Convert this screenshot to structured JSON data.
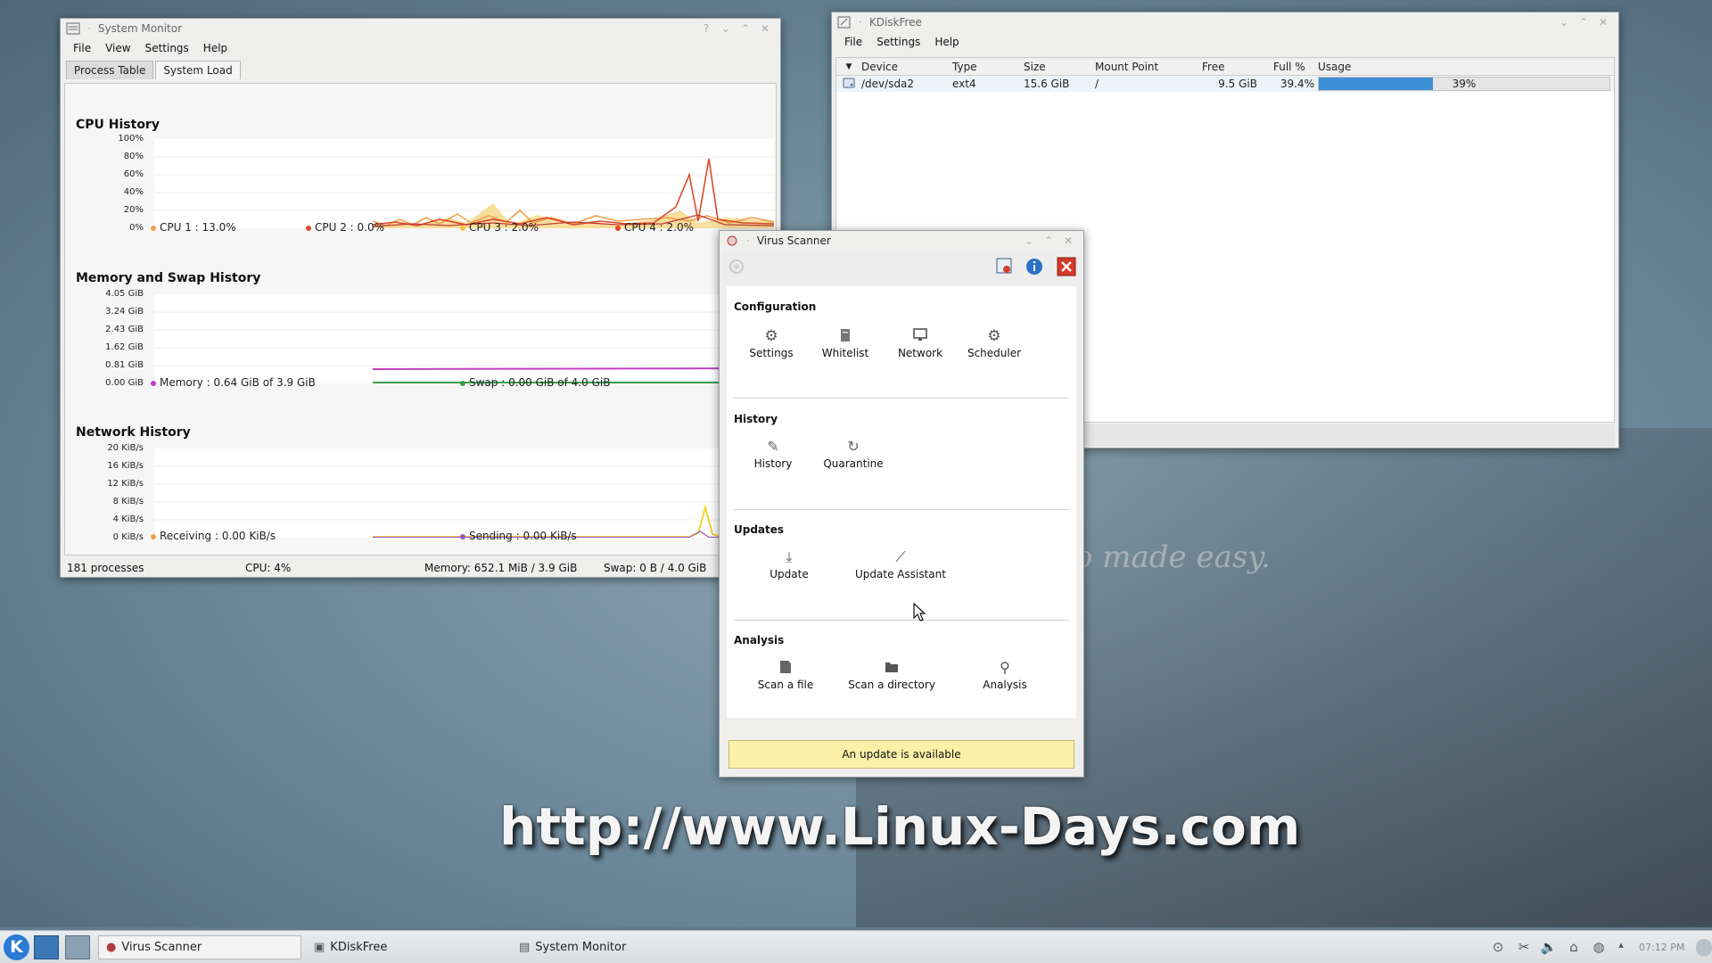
{
  "desktop": {
    "slogan": "o made easy.",
    "watermark": "http://www.Linux-Days.com"
  },
  "sysmon": {
    "title": "System Monitor",
    "menu": [
      "File",
      "View",
      "Settings",
      "Help"
    ],
    "tabs": [
      "Process Table",
      "System Load"
    ],
    "cpu": {
      "title": "CPU History",
      "yticks": [
        "100%",
        "80%",
        "60%",
        "40%",
        "20%",
        "0%"
      ],
      "legend": [
        "CPU 1 : 13.0%",
        "CPU 2 : 0.0%",
        "CPU 3 : 2.0%",
        "CPU 4 : 2.0%"
      ],
      "colors": [
        "#f0a04b",
        "#d94a2a",
        "#f5c542",
        "#e0442a"
      ]
    },
    "memory": {
      "title": "Memory and Swap History",
      "yticks": [
        "4.05 GiB",
        "3.24 GiB",
        "2.43 GiB",
        "1.62 GiB",
        "0.81 GiB",
        "0.00 GiB"
      ],
      "legend": [
        "Memory : 0.64 GiB of 3.9 GiB",
        "Swap : 0.00 GiB of 4.0 GiB"
      ],
      "colors": [
        "#c03fc0",
        "#3aa04a"
      ]
    },
    "network": {
      "title": "Network History",
      "yticks": [
        "20 KiB/s",
        "16 KiB/s",
        "12 KiB/s",
        "8 KiB/s",
        "4 KiB/s",
        "0 KiB/s"
      ],
      "legend": [
        "Receiving : 0.00 KiB/s",
        "Sending : 0.00 KiB/s"
      ],
      "colors": [
        "#f0a04b",
        "#9a5ab8"
      ]
    },
    "status": {
      "processes": "181 processes",
      "cpu": "CPU: 4%",
      "memory": "Memory: 652.1 MiB / 3.9 GiB",
      "swap": "Swap: 0 B / 4.0 GiB"
    }
  },
  "kdf": {
    "title": "KDiskFree",
    "menu": [
      "File",
      "Settings",
      "Help"
    ],
    "columns": [
      "Device",
      "Type",
      "Size",
      "Mount Point",
      "Free",
      "Full %",
      "Usage"
    ],
    "rows": [
      {
        "device": "/dev/sda2",
        "type": "ext4",
        "size": "15.6 GiB",
        "mount": "/",
        "free": "9.5 GiB",
        "full": "39.4%",
        "usage_label": "39%",
        "usage": 0.394
      }
    ]
  },
  "vs": {
    "title": "Virus Scanner",
    "sections": {
      "configuration": "Configuration",
      "history": "History",
      "updates": "Updates",
      "analysis": "Analysis"
    },
    "items": {
      "settings": "Settings",
      "whitelist": "Whitelist",
      "network": "Network",
      "scheduler": "Scheduler",
      "history": "History",
      "quarantine": "Quarantine",
      "update": "Update",
      "update_assistant": "Update Assistant",
      "scan_file": "Scan a file",
      "scan_directory": "Scan a directory",
      "analysis": "Analysis"
    },
    "banner": "An update is available"
  },
  "taskbar": {
    "tasks": [
      "Virus Scanner",
      "KDiskFree",
      "System Monitor"
    ],
    "clock": "07:12 PM"
  }
}
